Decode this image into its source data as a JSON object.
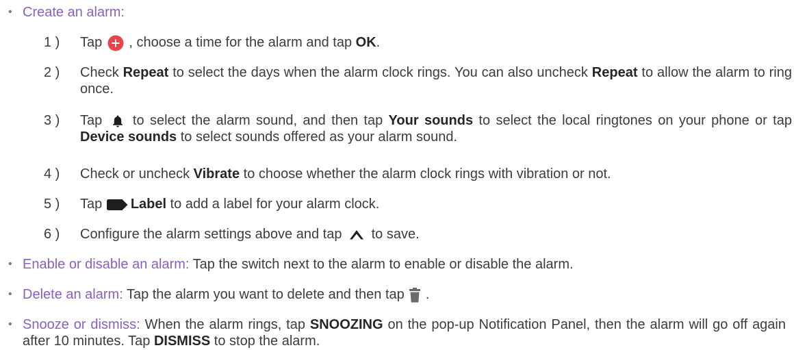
{
  "sections": [
    {
      "head": "Create an alarm",
      "sep": ":"
    },
    {
      "head": "Enable or disable an alarm",
      "sep": ":",
      "body": " Tap the switch next to the alarm to enable or disable the alarm."
    },
    {
      "head": "Delete an alarm",
      "sep": ":",
      "body_a": " Tap the alarm you want to delete and then tap ",
      "body_b": " ."
    },
    {
      "head": "Snooze or dismiss",
      "sep": ":",
      "body_a": " When the alarm rings, tap ",
      "bold1": "SNOOZING",
      "body_b": " on the pop-up Notification Panel, then the alarm will go off again after 10 minutes. Tap ",
      "bold2": "DISMISS",
      "body_c": " to stop the alarm."
    }
  ],
  "steps": [
    {
      "num": "1 )",
      "t1": "Tap ",
      "t2": " , choose a time for the alarm and tap ",
      "b1": "OK",
      "t3": "."
    },
    {
      "num": "2 )",
      "t1": "Check ",
      "b1": "Repeat",
      "t2": " to select the days when the alarm clock rings. You can also uncheck ",
      "b2": "Repeat",
      "t3": " to allow the alarm to ring once."
    },
    {
      "num": "3 )",
      "t1": "Tap ",
      "t2": " to select the alarm sound, and then tap ",
      "b1": "Your sounds",
      "t3": " to select the local ringtones on your phone or tap ",
      "b2": "Device sounds",
      "t4": " to select sounds offered as your alarm sound."
    },
    {
      "num": "4 )",
      "t1": "Check or uncheck ",
      "b1": "Vibrate",
      "t2": " to choose whether the alarm clock rings with vibration or not."
    },
    {
      "num": "5 )",
      "t1": "Tap ",
      "b1": "Label",
      "t2": " to add a label for your alarm clock."
    },
    {
      "num": "6 )",
      "t1": "Configure the alarm settings above and tap ",
      "t2": " to save."
    }
  ],
  "icons": {
    "add": "add-circle-icon",
    "bell": "bell-icon",
    "label": "label-tag-icon",
    "up": "chevron-up-icon",
    "delete": "trash-icon"
  },
  "colors": {
    "heading": "#8a5fc2",
    "add_icon": "#e8454a",
    "icon": "#1e1e1e",
    "trash": "#6a6a6a"
  }
}
